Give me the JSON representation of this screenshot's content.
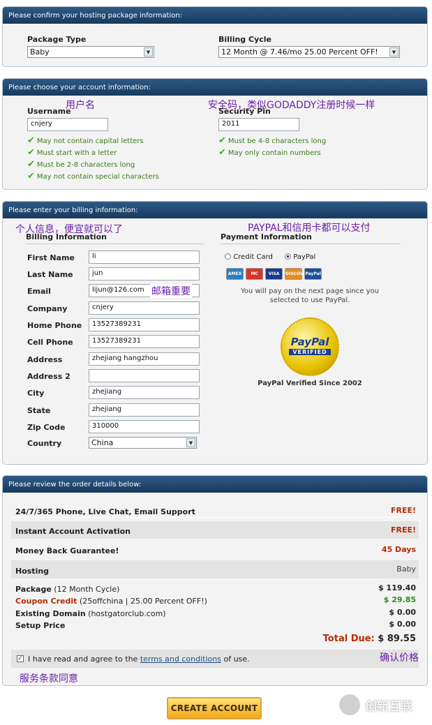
{
  "package_panel": {
    "header": "Please confirm your hosting package information:",
    "package_type_label": "Package Type",
    "package_type_value": "Baby",
    "billing_cycle_label": "Billing Cycle",
    "billing_cycle_value": "12 Month @ 7.46/mo 25.00 Percent OFF!"
  },
  "account_panel": {
    "header": "Please choose your account information:",
    "username_label": "Username",
    "username_value": "cnjery",
    "username_annotation": "用户名",
    "username_rules": [
      "May not contain capital letters",
      "Must start with a letter",
      "Must be 2-8 characters long",
      "May not contain special characters"
    ],
    "pin_label": "Security Pin",
    "pin_value": "2011",
    "pin_annotation": "安全码，类似GODADDY注册时候一样",
    "pin_rules": [
      "Must be 4-8 characters long",
      "May only contain numbers"
    ]
  },
  "billing_panel": {
    "header": "Please enter your billing information:",
    "billing_annotation": "个人信息，便宜就可以了",
    "billing_title": "Billing Information",
    "fields": [
      {
        "label": "First Name",
        "value": "li"
      },
      {
        "label": "Last Name",
        "value": "jun"
      },
      {
        "label": "Email",
        "value": "lijun@126.com"
      },
      {
        "label": "Company",
        "value": "cnjery"
      },
      {
        "label": "Home Phone",
        "value": "13527389231"
      },
      {
        "label": "Cell Phone",
        "value": "13527389231"
      },
      {
        "label": "Address",
        "value": "zhejiang hangzhou"
      },
      {
        "label": "Address 2",
        "value": ""
      },
      {
        "label": "City",
        "value": "zhejiang"
      },
      {
        "label": "State",
        "value": "zhejiang"
      },
      {
        "label": "Zip Code",
        "value": "310000"
      }
    ],
    "country_label": "Country",
    "country_value": "China",
    "email_annotation": "邮箱重要",
    "payment_annotation": "PAYPAL和信用卡都可以支付",
    "payment_title": "Payment Information",
    "credit_card_label": "Credit Card",
    "paypal_label": "PayPal",
    "cards": [
      "AMEX",
      "MC",
      "VISA",
      "DISCOVER",
      "PayPal"
    ],
    "paypal_note": "You will pay on the next page since you selected to use PayPal.",
    "seal_top": "PayPal",
    "seal_bottom": "VERIFIED",
    "verified_since": "PayPal Verified Since 2002"
  },
  "review_panel": {
    "header": "Please review the order details below:",
    "support_label": "24/7/365 Phone, Live Chat, Email Support",
    "support_value": "FREE!",
    "activation_label": "Instant Account Activation",
    "activation_value": "FREE!",
    "guarantee_label": "Money Back Guarantee!",
    "guarantee_value": "45 Days",
    "hosting_label": "Hosting",
    "hosting_value": "Baby",
    "package_label": "Package",
    "package_detail": "(12 Month Cycle)",
    "package_value": "$ 119.40",
    "coupon_label": "Coupon Credit",
    "coupon_detail": "(25offchina | 25.00 Percent OFF!)",
    "coupon_value": "$ 29.85",
    "domain_label": "Existing Domain",
    "domain_detail": "(hostgatorclub.com)",
    "domain_value": "$ 0.00",
    "setup_label": "Setup Price",
    "setup_value": "$ 0.00",
    "total_label": "Total Due:",
    "total_value": "$ 89.55",
    "price_annotation": "确认价格",
    "agree_prefix": "I have read and agree to the",
    "agree_link": "terms and conditions",
    "agree_suffix": "of use.",
    "agree_annotation": "服务条款同意"
  },
  "create_button": "CREATE ACCOUNT",
  "watermark": "创新互联",
  "colors": {
    "header": "#1e4670",
    "accent_red": "#b32d00",
    "green": "#2a8f1a",
    "annotation": "#6a1fa8",
    "button": "#f2a516"
  }
}
